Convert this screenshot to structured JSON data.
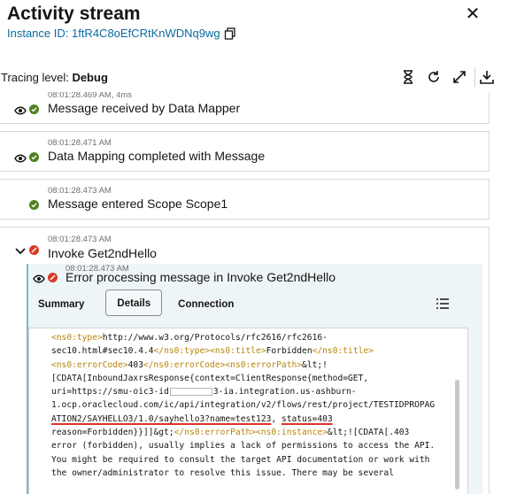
{
  "header": {
    "title": "Activity stream",
    "instance_label": "Instance ID: 1ftR4C8oEfCRtKnWDNq9wg",
    "close_glyph": "✕"
  },
  "toolbar": {
    "tracing_label": "Tracing level: ",
    "tracing_value": "Debug"
  },
  "stream": {
    "items": [
      {
        "timestamp": "08:01:28.469 AM, 4ms",
        "message": "Message received by Data Mapper",
        "status": "success"
      },
      {
        "timestamp": "08:01:28.471 AM",
        "message": "Data Mapping completed with Message",
        "status": "success"
      },
      {
        "timestamp": "08:01:28.473 AM",
        "message": "Message entered Scope Scope1",
        "status": "success"
      },
      {
        "timestamp": "08:01:28.473 AM",
        "message": "Invoke Get2ndHello",
        "status": "error"
      }
    ],
    "nested": {
      "timestamp": "08:01:28.473 AM",
      "message": "Error processing message in Invoke Get2ndHello",
      "status": "error",
      "tabs": [
        "Summary",
        "Details",
        "Connection"
      ],
      "active_tab": "Details"
    }
  },
  "details": {
    "l1a": "<ns0:type>",
    "l1b": "http://www.w3.org/Protocols/rfc2616/rfc2616-",
    "l2a": "sec10.html#sec10.4.4",
    "l2b": "</ns0:type>",
    "l2c": "<ns0:title>",
    "l2d": "Forbidden",
    "l2e": "</ns0:title>",
    "l3a": "<ns0:errorCode>",
    "l3b": "403",
    "l3c": "</ns0:errorCode>",
    "l3d": "<ns0:errorPath>",
    "l3e": "&lt;!",
    "l4": "[CDATA[InboundJaxrsResponse{context=ClientResponse{method=GET,",
    "l5a": "uri=https://smu-oic3-id",
    "l5b": "3-ia.integration.us-ashburn-",
    "l6": "1.ocp.oraclecloud.com/ic/api/integration/v2/flows/rest/project/TESTIDPROPAG",
    "l7a": "ATION2/SAYHELLO3/1.0/sayhello3?name=test123",
    "l7b": ", ",
    "l7c": "status=403",
    "l8a": "reason=Forbidden}}]]&gt;",
    "l8b": "</ns0:errorPath>",
    "l8c": "<ns0:instance>",
    "l8d": "&lt;![CDATA[.403",
    "l9": "error (forbidden), usually implies a lack of permissions to access the API.",
    "l10": "You might be required to consult the target API documentation or work with",
    "l11": "the owner/administrator to resolve this issue. There may be several"
  }
}
